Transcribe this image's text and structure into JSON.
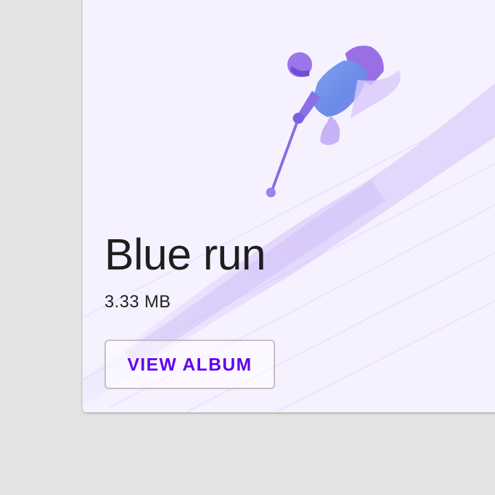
{
  "card": {
    "title": "Blue run",
    "subtitle": "3.33 MB",
    "button_label": "VIEW ALBUM"
  },
  "image": {
    "subject": "skier-photo",
    "tint_color": "#f4efff",
    "accent_color": "#a98ff0"
  },
  "colors": {
    "background": "#e3e3e3",
    "button_text": "#6200ee",
    "title_text": "#1e1e1e"
  }
}
